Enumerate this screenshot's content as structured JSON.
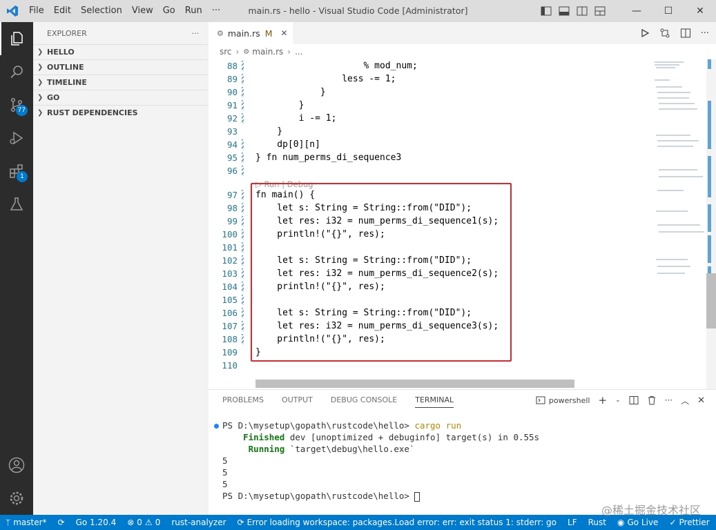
{
  "window": {
    "title": "main.rs - hello - Visual Studio Code [Administrator]",
    "menu": [
      "File",
      "Edit",
      "Selection",
      "View",
      "Go",
      "Run",
      "···"
    ],
    "controls": [
      "—",
      "☐",
      "✕"
    ]
  },
  "activity": {
    "scm_badge": "77",
    "extensions_badge": "1"
  },
  "sidebar": {
    "header": "EXPLORER",
    "more": "···",
    "sections": [
      "HELLO",
      "OUTLINE",
      "TIMELINE",
      "GO",
      "RUST DEPENDENCIES"
    ]
  },
  "tab": {
    "name": "main.rs",
    "modified": "M",
    "close": "✕"
  },
  "breadcrumb": [
    "src",
    "main.rs",
    "..."
  ],
  "code": {
    "lines": [
      {
        "n": "88",
        "text": "                    % mod_num;"
      },
      {
        "n": "89",
        "text": "                less -= 1;"
      },
      {
        "n": "90",
        "text": "            }"
      },
      {
        "n": "91",
        "text": "        }"
      },
      {
        "n": "92",
        "text": "        i -= 1;"
      },
      {
        "n": "93",
        "text": "    }"
      },
      {
        "n": "94",
        "text": "    dp[0][n]"
      },
      {
        "n": "95",
        "text": "} fn num_perms_di_sequence3"
      },
      {
        "n": "96",
        "text": ""
      },
      {
        "n": "",
        "text": "▷ Run | Debug"
      },
      {
        "n": "97",
        "text": "fn main() {"
      },
      {
        "n": "98",
        "text": "    let s: String = String::from(\"DID\");"
      },
      {
        "n": "99",
        "text": "    let res: i32 = num_perms_di_sequence1(s);"
      },
      {
        "n": "100",
        "text": "    println!(\"{}\", res);"
      },
      {
        "n": "101",
        "text": ""
      },
      {
        "n": "102",
        "text": "    let s: String = String::from(\"DID\");"
      },
      {
        "n": "103",
        "text": "    let res: i32 = num_perms_di_sequence2(s);"
      },
      {
        "n": "104",
        "text": "    println!(\"{}\", res);"
      },
      {
        "n": "105",
        "text": ""
      },
      {
        "n": "106",
        "text": "    let s: String = String::from(\"DID\");"
      },
      {
        "n": "107",
        "text": "    let res: i32 = num_perms_di_sequence3(s);"
      },
      {
        "n": "108",
        "text": "    println!(\"{}\", res);"
      },
      {
        "n": "109",
        "text": "}"
      },
      {
        "n": "110",
        "text": ""
      }
    ]
  },
  "panel": {
    "tabs": [
      "PROBLEMS",
      "OUTPUT",
      "DEBUG CONSOLE",
      "TERMINAL"
    ],
    "active_tab": "TERMINAL",
    "shell": "powershell",
    "terminal": {
      "prompt": "PS D:\\mysetup\\gopath\\rustcode\\hello> ",
      "command": "cargo run",
      "finished_label": "Finished",
      "finished_text": " dev [unoptimized + debuginfo] target(s) in 0.55s",
      "running_label": "Running",
      "running_text": " `target\\debug\\hello.exe`",
      "outputs": [
        "5",
        "5",
        "5"
      ],
      "final_prompt": "PS D:\\mysetup\\gopath\\rustcode\\hello> "
    }
  },
  "statusbar": {
    "branch": "master*",
    "go_version": "Go 1.20.4",
    "errors": "0",
    "warnings": "0",
    "rust_analyzer": "rust-analyzer",
    "error_msg": "Error loading workspace: packages.Load error: err: exit status 1: stderr: go",
    "eol": "LF",
    "language": "Rust",
    "go_live": "Go Live",
    "prettier": "Prettier"
  },
  "watermark": "@稀土掘金技术社区",
  "colors": {
    "accent": "#007acc",
    "highlight_box": "#e0252b"
  }
}
